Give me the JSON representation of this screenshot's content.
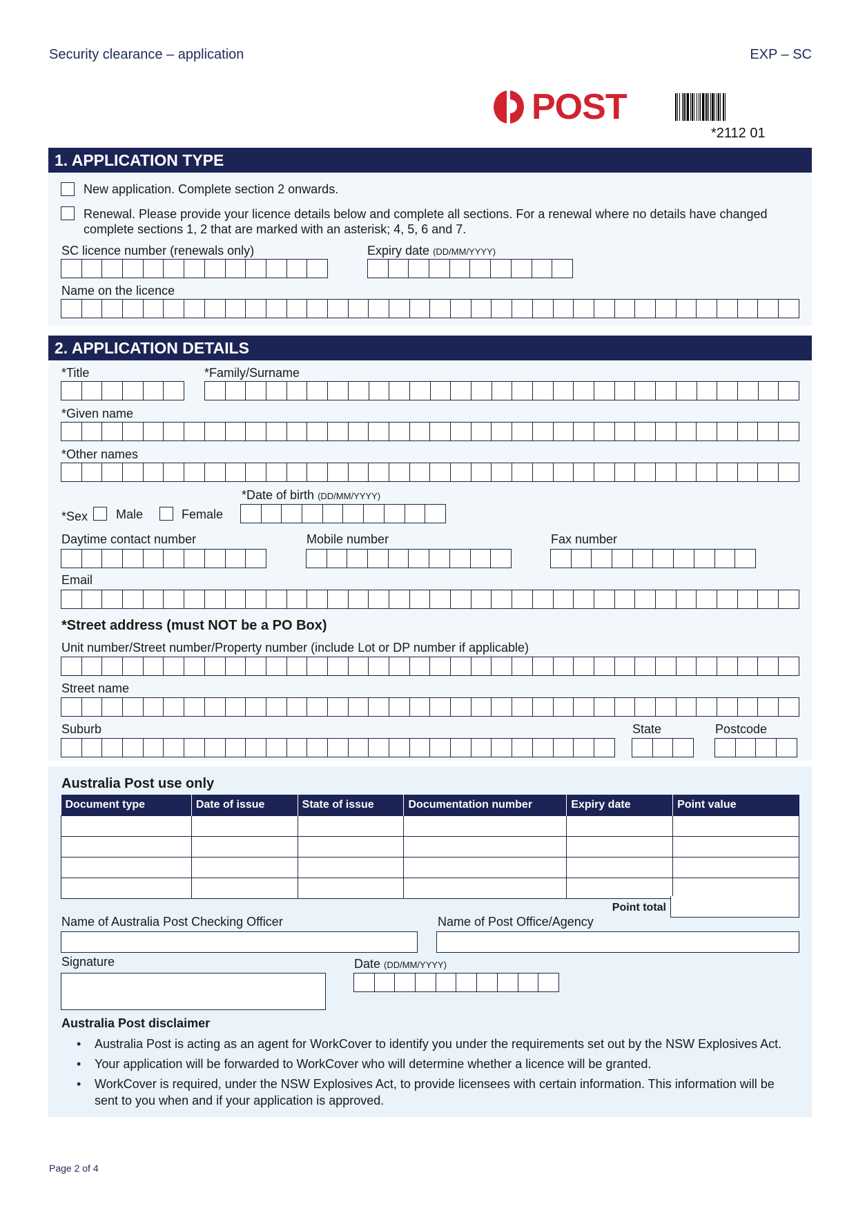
{
  "header": {
    "form_title": "Security clearance – application",
    "form_code": "EXP – SC",
    "logo_text": "POST",
    "barcode_number": "*2112 01",
    "brand_color": "#d0232f",
    "navy": "#1c2455"
  },
  "section1": {
    "title": "1. APPLICATION TYPE",
    "options": [
      {
        "label": "New application. Complete section 2 onwards."
      },
      {
        "label": "Renewal. Please provide your licence details below and complete all sections. For a renewal where no details have changed complete sections 1, 2 that are marked with an asterisk; 4, 5, 6 and 7."
      }
    ],
    "licence_number": {
      "label": "SC licence number (renewals only)",
      "boxes": 13
    },
    "expiry_date": {
      "label": "Expiry date",
      "hint": "(DD/MM/YYYY)",
      "boxes": 10
    },
    "name_on_licence": {
      "label": "Name on the licence",
      "boxes": 36
    }
  },
  "section2": {
    "title": "2. APPLICATION DETAILS",
    "title_field": {
      "label": "*Title",
      "boxes": 6
    },
    "surname": {
      "label": "*Family/Surname",
      "boxes": 29
    },
    "given_name": {
      "label": "*Given name",
      "boxes": 36
    },
    "other_names": {
      "label": "*Other names",
      "boxes": 36
    },
    "sex": {
      "label": "*Sex",
      "male": "Male",
      "female": "Female"
    },
    "dob": {
      "label": "*Date of birth",
      "hint": "(DD/MM/YYYY)",
      "boxes": 10
    },
    "daytime": {
      "label": "Daytime contact number",
      "boxes": 10
    },
    "mobile": {
      "label": "Mobile number",
      "boxes": 10
    },
    "fax": {
      "label": "Fax number",
      "boxes": 10
    },
    "email": {
      "label": "Email",
      "boxes": 36
    },
    "street_heading": "*Street address (must NOT be a PO Box)",
    "unit": {
      "label": "Unit number/Street number/Property number (include Lot or DP number if applicable)",
      "boxes": 36
    },
    "street_name": {
      "label": "Street name",
      "boxes": 36
    },
    "suburb": {
      "label": "Suburb",
      "boxes": 27
    },
    "state": {
      "label": "State",
      "boxes": 3
    },
    "postcode": {
      "label": "Postcode",
      "boxes": 4
    }
  },
  "post_use": {
    "heading": "Australia Post use only",
    "columns": [
      "Document type",
      "Date of issue",
      "State of issue",
      "Documentation number",
      "Expiry date",
      "Point value"
    ],
    "rows": [
      [
        "",
        "",
        "",
        "",
        "",
        ""
      ],
      [
        "",
        "",
        "",
        "",
        "",
        ""
      ],
      [
        "",
        "",
        "",
        "",
        "",
        ""
      ],
      [
        "",
        "",
        "",
        "",
        "",
        ""
      ]
    ],
    "point_total_label": "Point total",
    "officer_label": "Name of Australia Post Checking Officer",
    "agency_label": "Name of Post Office/Agency",
    "signature_label": "Signature",
    "date_label": "Date",
    "date_hint": "(DD/MM/YYYY)",
    "date_boxes": 10
  },
  "disclaimer": {
    "heading": "Australia Post disclaimer",
    "items": [
      "Australia Post is acting as an agent for WorkCover to identify you under the requirements set out by the NSW Explosives Act.",
      "Your application will be forwarded to WorkCover who will determine whether a licence will be granted.",
      "WorkCover is required, under the NSW Explosives Act, to provide licensees with certain information. This information will be sent to you when and if your application is approved."
    ]
  },
  "footer": {
    "page": "Page 2 of 4"
  }
}
